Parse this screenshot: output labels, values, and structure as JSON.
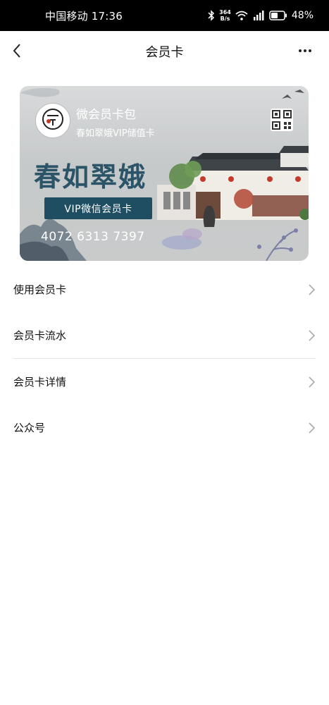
{
  "status_bar": {
    "carrier_time": "中国移动 17:36",
    "net_speed_value": "364",
    "net_speed_unit": "B/s",
    "battery": "48%"
  },
  "header": {
    "title": "会员卡"
  },
  "card": {
    "wallet_title": "微会员卡包",
    "card_name": "春如翠娥VIP储值卡",
    "brand": "春如翠娥",
    "badge": "VIP微信会员卡",
    "number": "4072 6313 7397",
    "logo_text": "春如翠娥"
  },
  "menu": {
    "items": [
      {
        "label": "使用会员卡"
      },
      {
        "label": "会员卡流水"
      },
      {
        "label": "会员卡详情"
      },
      {
        "label": "公众号"
      }
    ]
  },
  "colors": {
    "badge_bg": "#1f4e63",
    "brand_text": "#2c5468"
  }
}
